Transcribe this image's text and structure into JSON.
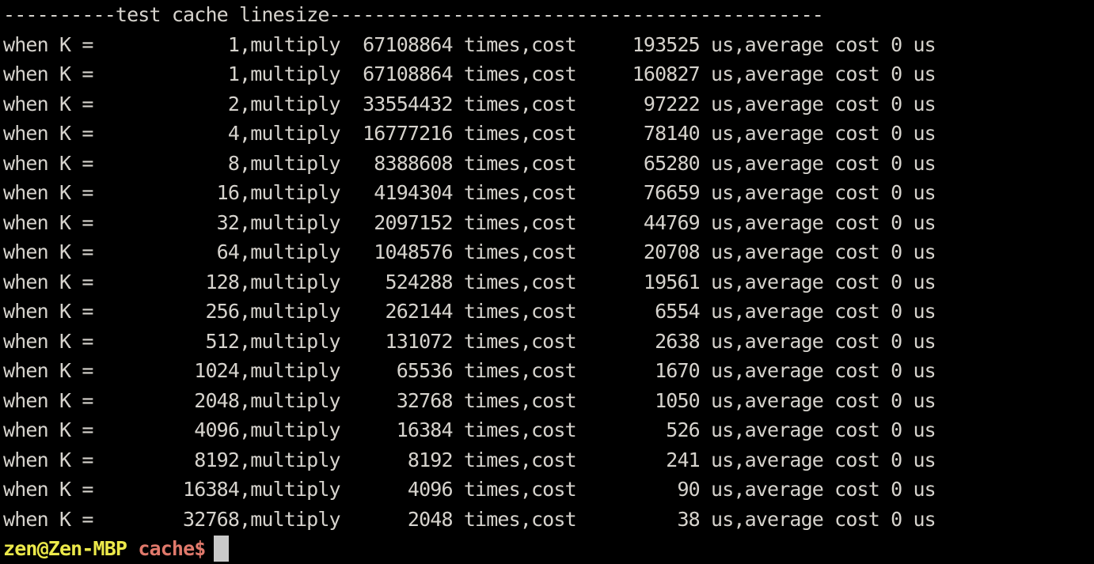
{
  "terminal": {
    "background_color": "#000000",
    "foreground_color": "#d6d3cd",
    "cursor_color": "#c9c9c9",
    "prompt_user_color": "#ece94a",
    "prompt_dir_color": "#e0796b",
    "header": "----------test cache linesize--------------------------------------------",
    "row_prefix": "when K = ",
    "row_mid_1": ",multiply ",
    "row_mid_2": " times,cost ",
    "row_suffix": " us,average cost 0 us",
    "rows": [
      {
        "k": "1",
        "times": "67108864",
        "cost": "193525",
        "line": "when K =            1,multiply  67108864 times,cost     193525 us,average cost 0 us"
      },
      {
        "k": "1",
        "times": "67108864",
        "cost": "160827",
        "line": "when K =            1,multiply  67108864 times,cost     160827 us,average cost 0 us"
      },
      {
        "k": "2",
        "times": "33554432",
        "cost": "97222",
        "line": "when K =            2,multiply  33554432 times,cost      97222 us,average cost 0 us"
      },
      {
        "k": "4",
        "times": "16777216",
        "cost": "78140",
        "line": "when K =            4,multiply  16777216 times,cost      78140 us,average cost 0 us"
      },
      {
        "k": "8",
        "times": "8388608",
        "cost": "65280",
        "line": "when K =            8,multiply   8388608 times,cost      65280 us,average cost 0 us"
      },
      {
        "k": "16",
        "times": "4194304",
        "cost": "76659",
        "line": "when K =           16,multiply   4194304 times,cost      76659 us,average cost 0 us"
      },
      {
        "k": "32",
        "times": "2097152",
        "cost": "44769",
        "line": "when K =           32,multiply   2097152 times,cost      44769 us,average cost 0 us"
      },
      {
        "k": "64",
        "times": "1048576",
        "cost": "20708",
        "line": "when K =           64,multiply   1048576 times,cost      20708 us,average cost 0 us"
      },
      {
        "k": "128",
        "times": "524288",
        "cost": "19561",
        "line": "when K =          128,multiply    524288 times,cost      19561 us,average cost 0 us"
      },
      {
        "k": "256",
        "times": "262144",
        "cost": "6554",
        "line": "when K =          256,multiply    262144 times,cost       6554 us,average cost 0 us"
      },
      {
        "k": "512",
        "times": "131072",
        "cost": "2638",
        "line": "when K =          512,multiply    131072 times,cost       2638 us,average cost 0 us"
      },
      {
        "k": "1024",
        "times": "65536",
        "cost": "1670",
        "line": "when K =         1024,multiply     65536 times,cost       1670 us,average cost 0 us"
      },
      {
        "k": "2048",
        "times": "32768",
        "cost": "1050",
        "line": "when K =         2048,multiply     32768 times,cost       1050 us,average cost 0 us"
      },
      {
        "k": "4096",
        "times": "16384",
        "cost": "526",
        "line": "when K =         4096,multiply     16384 times,cost        526 us,average cost 0 us"
      },
      {
        "k": "8192",
        "times": "8192",
        "cost": "241",
        "line": "when K =         8192,multiply      8192 times,cost        241 us,average cost 0 us"
      },
      {
        "k": "16384",
        "times": "4096",
        "cost": "90",
        "line": "when K =        16384,multiply      4096 times,cost         90 us,average cost 0 us"
      },
      {
        "k": "32768",
        "times": "2048",
        "cost": "38",
        "line": "when K =        32768,multiply      2048 times,cost         38 us,average cost 0 us"
      }
    ],
    "prompt": {
      "user_host": "zen@Zen-MBP",
      "separator": " ",
      "directory_symbol": "cache$",
      "command_text": ""
    }
  }
}
